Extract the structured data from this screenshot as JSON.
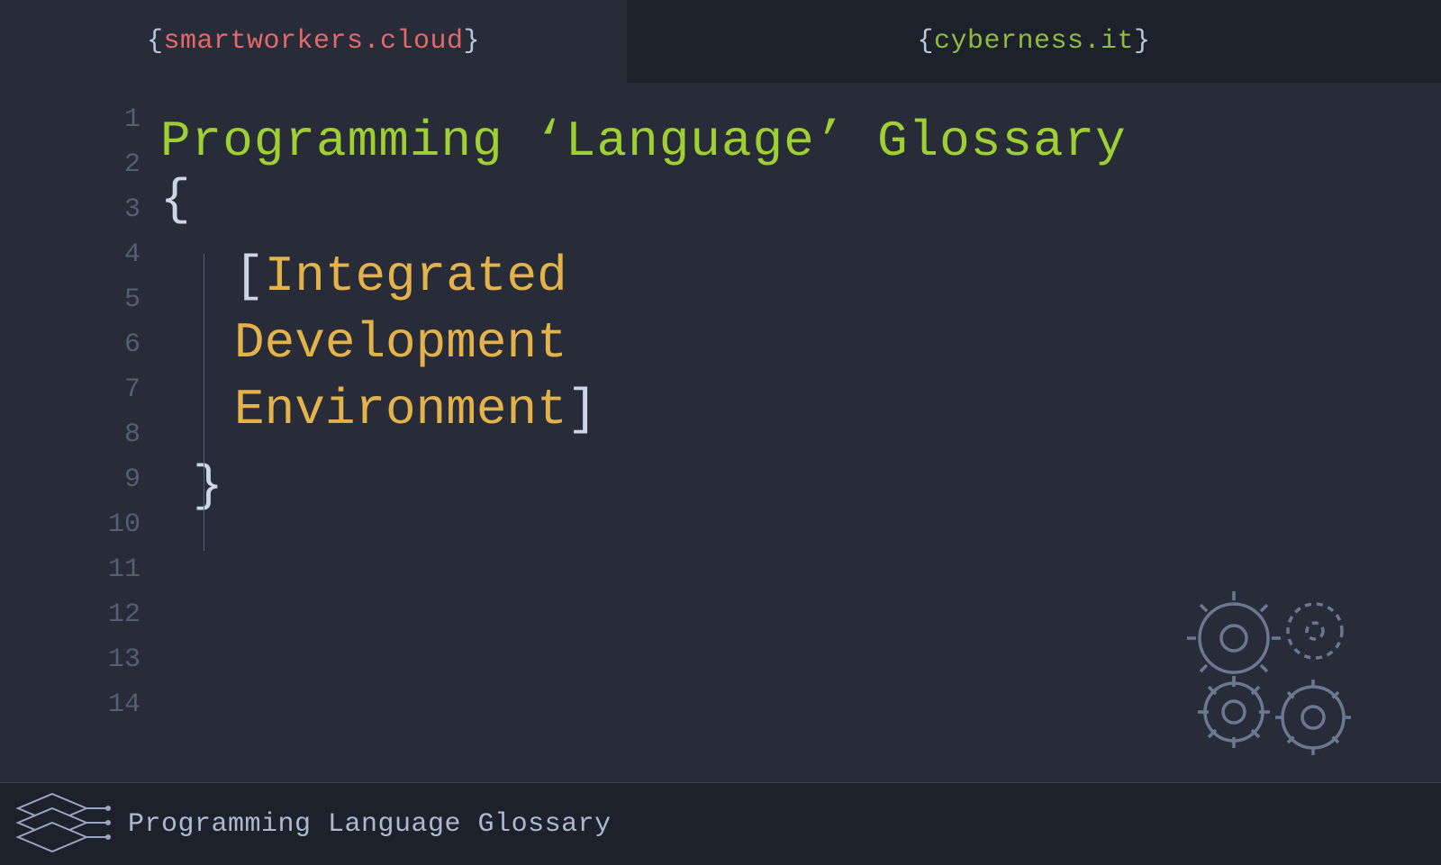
{
  "tabs": {
    "left": {
      "open": "{",
      "domain": "smartworkers.cloud",
      "close": "}"
    },
    "right": {
      "open": "{",
      "domain": "cyberness.it",
      "close": "}"
    }
  },
  "editor": {
    "line_numbers": [
      "1",
      "2",
      "3",
      "4",
      "5",
      "6",
      "7",
      "8",
      "9",
      "10",
      "11",
      "12",
      "13",
      "14"
    ],
    "title": "Programming ‘Language’ Glossary",
    "brace_open": "{",
    "brace_close": "}",
    "bracket_open": "[",
    "bracket_close": "]",
    "term_lines": [
      "Integrated",
      "Development",
      "Environment"
    ]
  },
  "footer": {
    "text": "Programming Language Glossary"
  }
}
